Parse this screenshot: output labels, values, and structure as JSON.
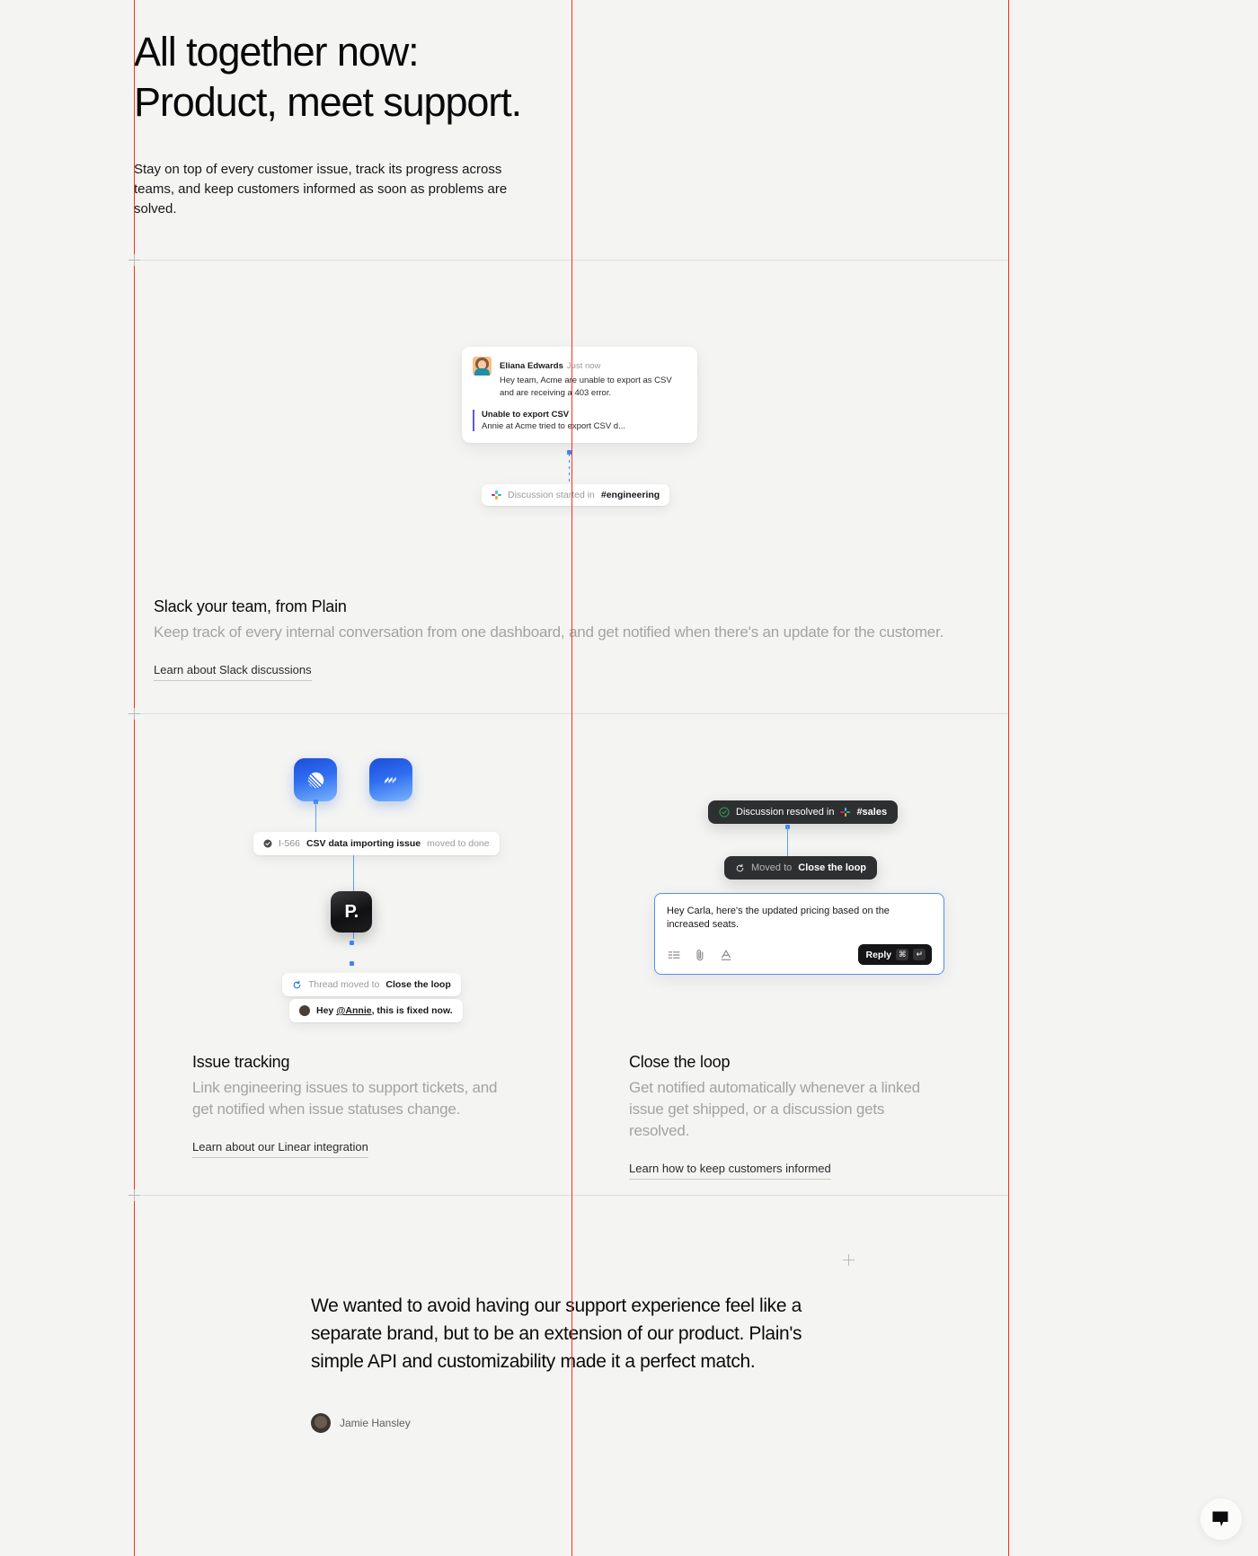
{
  "hero": {
    "title_line1": "All together now:",
    "title_line2": "Product, meet support.",
    "subtitle": "Stay on top of every customer issue, track its progress across teams, and keep customers informed as soon as problems are solved."
  },
  "slack_section": {
    "card": {
      "author": "Eliana Edwards",
      "timestamp": "Just now",
      "message": "Hey team, Acme are unable to export as CSV and are receiving a 403 error.",
      "quote_title": "Unable to export CSV",
      "quote_subtitle": "Annie at Acme tried to export CSV d..."
    },
    "pill_prefix": "Discussion started in",
    "pill_channel": "#engineering",
    "title": "Slack your team, from Plain",
    "body": "Keep track of every internal conversation from one dashboard, and get notified when there's an update for the customer.",
    "link": "Learn about Slack discussions"
  },
  "issue_tracking": {
    "tile_linear": "linear-app-icon",
    "tile_jira": "jira-app-icon",
    "issue_pill": {
      "id": "I-566",
      "name": "CSV data importing issue",
      "status": "moved to done"
    },
    "plain_logo": "P.",
    "thread_pill_prefix": "Thread moved to",
    "thread_pill_target": "Close the loop",
    "reply_pill": {
      "greeting": "Hey ",
      "mention": "@Annie",
      "rest": ", this is fixed now."
    },
    "title": "Issue tracking",
    "body": "Link engineering issues to support tickets, and get notified when issue statuses change.",
    "link": "Learn about our Linear integration"
  },
  "close_the_loop": {
    "resolved_pill_prefix": "Discussion resolved in",
    "resolved_pill_channel": "#sales",
    "moved_pill_prefix": "Moved to",
    "moved_pill_target": "Close the loop",
    "composer": {
      "text": "Hey Carla, here's the updated pricing based on the increased seats.",
      "reply_label": "Reply",
      "shortcut_cmd": "⌘",
      "shortcut_enter": "↵"
    },
    "title": "Close the loop",
    "body": "Get notified automatically whenever a linked issue get shipped, or a discussion gets resolved.",
    "link": "Learn how to keep customers informed"
  },
  "quote": {
    "text": "We wanted to avoid having our support experience feel like a separate brand, but to be an extension of our product. Plain's simple API and customizability made it a perfect match.",
    "author": "Jamie Hansley"
  },
  "chat_widget": {
    "icon": "chat-bubble-icon"
  },
  "colors": {
    "page_bg": "#f4f4f3",
    "guide_red": "#ff2d16",
    "accent_blue": "#3f83f8",
    "muted_text": "#a3a3a1"
  }
}
